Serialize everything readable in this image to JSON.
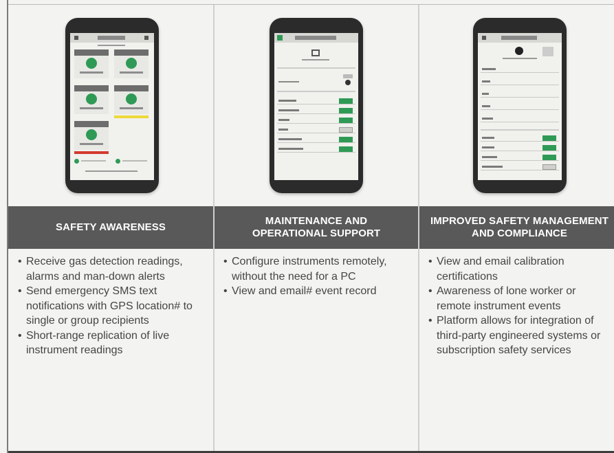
{
  "columns": [
    {
      "header": "SAFETY AWARENESS",
      "bullets": [
        "Receive gas detection readings, alarms and man-down alerts",
        "Send emergency SMS text notifications with GPS location# to single or group recipients",
        "Short-range replication of live instrument readings"
      ]
    },
    {
      "header": "MAINTENANCE AND\nOPERATIONAL SUPPORT",
      "bullets": [
        "Configure instruments remotely, without the need for a PC",
        "View and email# event record"
      ]
    },
    {
      "header": "IMPROVED SAFETY MANAGEMENT\nAND COMPLIANCE",
      "bullets": [
        "View and email calibration certifications",
        "Awareness of lone worker or remote instrument events",
        "Platform allows for integration of third-party engineered systems or subscription safety services"
      ]
    }
  ],
  "colors": {
    "header_band": "#595959",
    "header_text": "#ffffff",
    "status_green": "#2f9a55",
    "alert_yellow": "#ecd938",
    "alert_red": "#d23a2f"
  },
  "phones": [
    {
      "name": "phone-dashboard-screenshot"
    },
    {
      "name": "phone-configuration-screenshot"
    },
    {
      "name": "phone-instrument-details-screenshot"
    }
  ]
}
